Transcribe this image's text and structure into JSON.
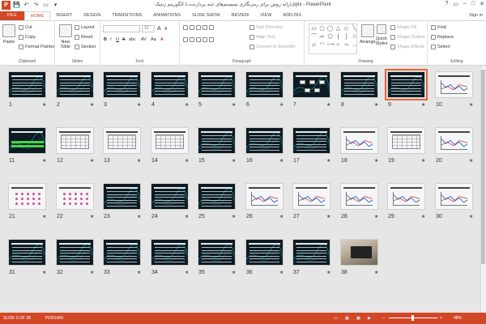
{
  "app": {
    "title": "ارائه روش برای رمزنگاری سیستم‌های چند پردازنده با الگوریتم ژنتیک.pptx - PowerPoint",
    "logo_letter": "P",
    "sign_in": "Sign in",
    "window_controls": [
      "?",
      "▭",
      "–",
      "□",
      "✕"
    ]
  },
  "qat": {
    "save_glyph": "💾",
    "undo_glyph": "↶",
    "redo_glyph": "↷",
    "start_glyph": "▭",
    "more_glyph": "▾"
  },
  "tabs": [
    "FILE",
    "HOME",
    "INSERT",
    "DESIGN",
    "TRANSITIONS",
    "ANIMATIONS",
    "SLIDE SHOW",
    "REVIEW",
    "VIEW",
    "ADD-INS"
  ],
  "ribbon": {
    "clipboard": {
      "label": "Clipboard",
      "paste": "Paste",
      "cut": "Cut",
      "copy": "Copy",
      "format_painter": "Format Painter"
    },
    "slides": {
      "label": "Slides",
      "new_slide": "New Slide",
      "layout": "Layout",
      "reset": "Reset",
      "section": "Section"
    },
    "font": {
      "label": "Font",
      "font_name": "",
      "font_size": "12",
      "grow": "A",
      "shrink": "A",
      "bold": "B",
      "italic": "I",
      "underline": "U",
      "strike": "S",
      "shadow": "abc",
      "spacing": "AV",
      "case": "Aa",
      "color": "A"
    },
    "paragraph": {
      "label": "Paragraph",
      "text_direction": "Text Direction",
      "align_text": "Align Text",
      "convert_smartart": "Convert to SmartArt"
    },
    "drawing": {
      "label": "Drawing",
      "arrange": "Arrange",
      "quick_styles": "Quick Styles",
      "shape_fill": "Shape Fill",
      "shape_outline": "Shape Outline",
      "shape_effects": "Shape Effects",
      "shapes": [
        "▭",
        "▢",
        "◯",
        "△",
        "◇",
        "╲",
        "⌒",
        "⇨",
        "⬠",
        "{",
        "}",
        "☆",
        "▱",
        "◠",
        "⟶",
        "⌐",
        "⤳",
        "…"
      ]
    },
    "editing": {
      "label": "Editing",
      "find": "Find",
      "replace": "Replace",
      "select": "Select"
    }
  },
  "slides": [
    {
      "n": "1"
    },
    {
      "n": "2"
    },
    {
      "n": "3"
    },
    {
      "n": "4"
    },
    {
      "n": "5"
    },
    {
      "n": "6"
    },
    {
      "n": "7"
    },
    {
      "n": "8"
    },
    {
      "n": "9"
    },
    {
      "n": "10"
    },
    {
      "n": "11"
    },
    {
      "n": "12"
    },
    {
      "n": "13"
    },
    {
      "n": "14"
    },
    {
      "n": "15"
    },
    {
      "n": "16"
    },
    {
      "n": "17"
    },
    {
      "n": "18"
    },
    {
      "n": "19"
    },
    {
      "n": "20"
    },
    {
      "n": "21"
    },
    {
      "n": "22"
    },
    {
      "n": "23"
    },
    {
      "n": "24"
    },
    {
      "n": "25"
    },
    {
      "n": "26"
    },
    {
      "n": "27"
    },
    {
      "n": "28"
    },
    {
      "n": "29"
    },
    {
      "n": "30"
    },
    {
      "n": "31"
    },
    {
      "n": "32"
    },
    {
      "n": "33"
    },
    {
      "n": "34"
    },
    {
      "n": "35"
    },
    {
      "n": "36"
    },
    {
      "n": "37"
    },
    {
      "n": "38"
    }
  ],
  "selected_slide": "9",
  "star_glyph": "★",
  "status": {
    "slide_info": "SLIDE 9 OF 38",
    "language": "PERSIAN",
    "zoom": "48%",
    "minus": "–",
    "plus": "+"
  },
  "colors": {
    "accent": "#d24726",
    "selection": "#e8613a",
    "slide_bg": "#0d1b22"
  }
}
